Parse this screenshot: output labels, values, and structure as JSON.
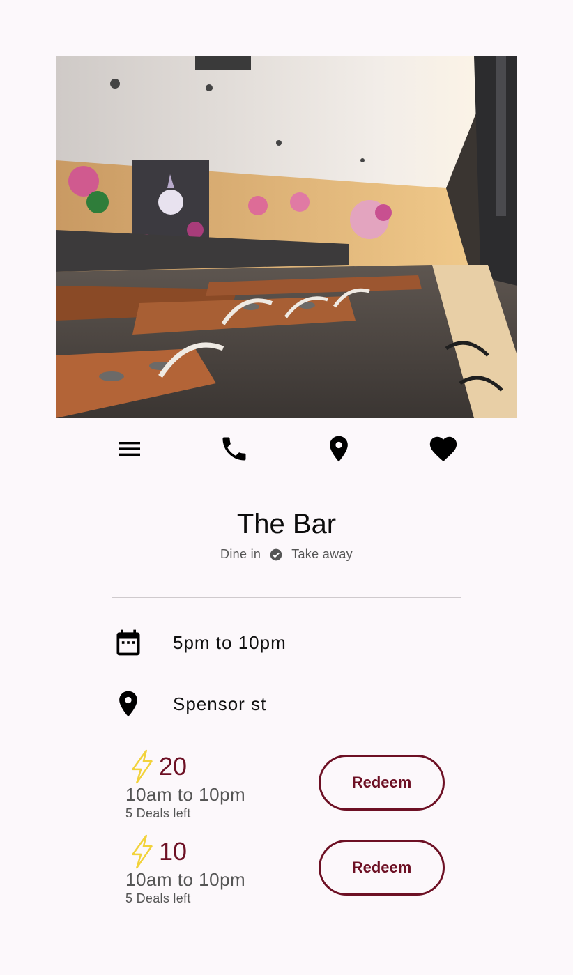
{
  "hero": {
    "alt": "Restaurant interior"
  },
  "actions": [
    {
      "name": "menu",
      "icon": "menu-icon"
    },
    {
      "name": "call",
      "icon": "phone-icon"
    },
    {
      "name": "location",
      "icon": "location-pin-icon"
    },
    {
      "name": "favorite",
      "icon": "heart-icon"
    }
  ],
  "venue": {
    "title": "The Bar",
    "tag_dine_in": "Dine in",
    "tag_take_away": "Take away"
  },
  "info": {
    "hours": "5pm to 10pm",
    "address": "Spensor st"
  },
  "deals": [
    {
      "amount": "20",
      "time": "10am to 10pm",
      "remaining": "5 Deals left",
      "button": "Redeem"
    },
    {
      "amount": "10",
      "time": "10am to 10pm",
      "remaining": "5 Deals left",
      "button": "Redeem"
    }
  ],
  "colors": {
    "background": "#fcf8fb",
    "accent": "#6d1024",
    "bolt": "#f2d23a",
    "divider": "#cfcacd"
  }
}
